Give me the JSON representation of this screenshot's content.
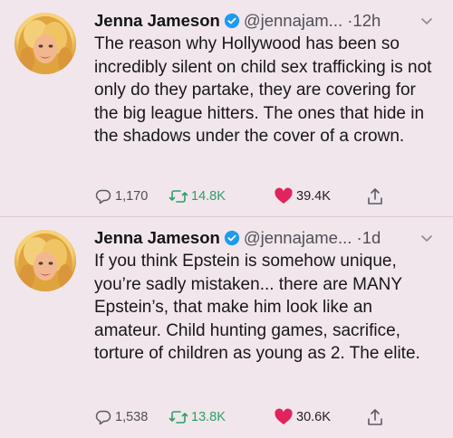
{
  "tweets": [
    {
      "name": "Jenna Jameson",
      "handle": "@jennajam...",
      "time": "12h",
      "text": "The reason why Hollywood has been so incredibly silent on child sex trafficking is not only do they partake, they are covering for the big league hitters. The ones that hide in the shadows under the cover of a crown.",
      "replies": "1,170",
      "retweets": "14.8K",
      "likes": "39.4K"
    },
    {
      "name": "Jenna Jameson",
      "handle": "@jennajame...",
      "time": "1d",
      "text": "If you think Epstein is somehow unique, you’re sadly mistaken... there are MANY Epstein’s, that make him look like an amateur. Child hunting games, sacrifice, torture of children as young as 2. The elite.",
      "replies": "1,538",
      "retweets": "13.8K",
      "likes": "30.6K"
    }
  ],
  "separator": "·",
  "icons": {
    "verified": "verified-badge-icon",
    "menu": "chevron-down-icon",
    "reply": "reply-icon",
    "retweet": "retweet-icon",
    "like": "heart-icon",
    "share": "share-icon"
  },
  "colors": {
    "background": "#f1e6ec",
    "verified": "#1d9bf0",
    "retweet": "#2f9e6a",
    "like": "#e0245e"
  }
}
